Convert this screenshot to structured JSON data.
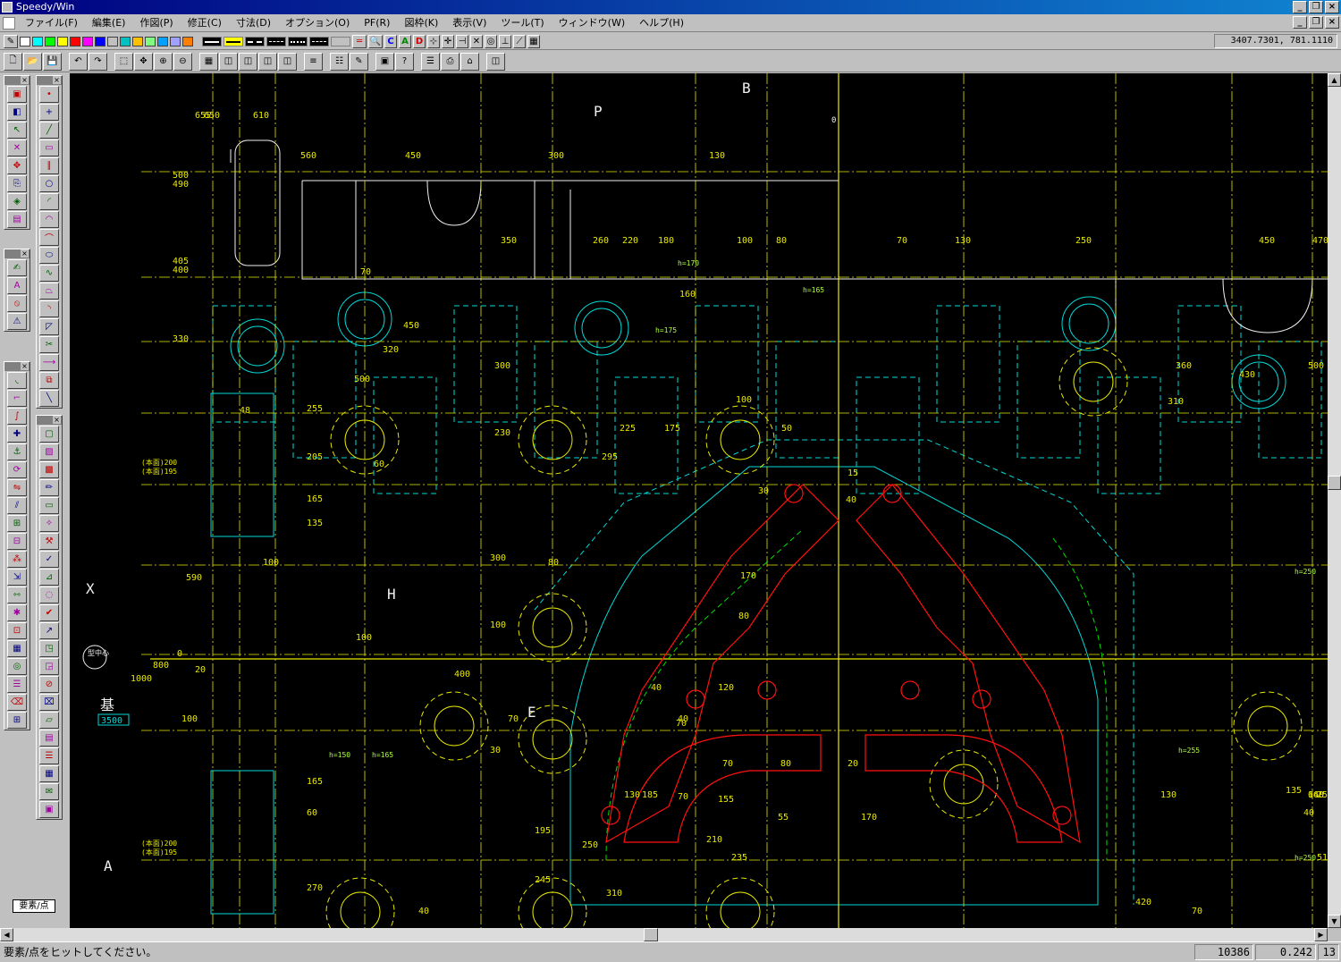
{
  "window": {
    "title": "Speedy/Win"
  },
  "menu": [
    "ファイル(F)",
    "編集(E)",
    "作図(P)",
    "修正(C)",
    "寸法(D)",
    "オプション(O)",
    "PF(R)",
    "図枠(K)",
    "表示(V)",
    "ツール(T)",
    "ウィンドウ(W)",
    "ヘルプ(H)"
  ],
  "toolbar": {
    "coords": "3407.7301,   781.1110",
    "icons": [
      "new-icon",
      "open-icon",
      "save-icon",
      "undo-icon",
      "redo-icon",
      "zoom-window-icon",
      "zoom-pan-icon",
      "zoom-all-icon",
      "zoom-out-icon",
      "calculator-icon",
      "data-1-icon",
      "data-2-icon",
      "data-3-icon",
      "data-4-icon",
      "layer-icon",
      "layer-list-icon",
      "pen-icon",
      "display-icon",
      "help-pointer-icon",
      "property-icon",
      "print-icon",
      "plot-icon",
      "data-5-icon"
    ],
    "swatch_colors": [
      "#ffffff",
      "#00ffff",
      "#00ff00",
      "#ffff00",
      "#ff0000",
      "#ff00ff",
      "#0000ff",
      "#c0c0c0",
      "#00c0c0",
      "#ffc000",
      "#80ff80",
      "#00a0ff",
      "#a0a0ff",
      "#ff8000"
    ]
  },
  "palettes": {
    "a_icons": [
      "file-open-icon",
      "file-save-icon",
      "select-arrow-icon",
      "delete-icon",
      "move-icon",
      "copy-icon",
      "layer-change-icon",
      "hatch-icon"
    ],
    "b_icons": [
      "point-icon",
      "line-cross-icon",
      "line-icon",
      "rect-icon",
      "parallel-icon",
      "circle-icon",
      "arc-icon",
      "arc-3pt-icon",
      "tangent-icon",
      "ellipse-icon",
      "spline-icon",
      "polyline-icon",
      "fillet-icon",
      "chamfer-icon",
      "trim-icon",
      "extend-icon",
      "offset-icon",
      "diag-line-icon"
    ],
    "c_icons": [
      "dimension-icon",
      "text-icon",
      "balloon-icon",
      "warning-icon"
    ],
    "d_icons": [
      "arc-dim-icon",
      "corner-icon",
      "curve-icon",
      "cross-snap-icon",
      "anchor-icon",
      "rotate-icon",
      "mirror-icon",
      "split-icon",
      "join-icon",
      "break-icon",
      "array-icon",
      "scale-icon",
      "stretch-icon",
      "explode-icon",
      "group-icon",
      "table-icon",
      "circle-snap-icon",
      "list-icon",
      "eraser-icon",
      "grid-icon"
    ],
    "e_icons": [
      "box-icon",
      "hatch-pattern-icon",
      "fill-icon",
      "pencil-icon",
      "frame-icon",
      "symbol-icon",
      "weld-icon",
      "finish-icon",
      "tolerance-icon",
      "datum-icon",
      "check-icon",
      "leader-icon",
      "detail-icon",
      "view-icon",
      "section-icon",
      "rubber-icon",
      "print-area-icon",
      "data-table-icon",
      "bom-icon",
      "stamp-icon",
      "note-icon",
      "frame-2-icon"
    ]
  },
  "mode_label": "要素/点",
  "drawing": {
    "labels": [
      "P",
      "B",
      "A",
      "H",
      "E",
      "X",
      "0"
    ],
    "dims_yellow": [
      "655",
      "650",
      "610",
      "560",
      "450",
      "300",
      "130",
      "500",
      "490",
      "405",
      "400",
      "350",
      "260",
      "220",
      "180",
      "160",
      "100",
      "80",
      "70",
      "130",
      "250",
      "450",
      "470",
      "360",
      "330",
      "70",
      "450",
      "320",
      "300",
      "255",
      "230",
      "205",
      "165",
      "135",
      "500",
      "225",
      "295",
      "175",
      "100",
      "50",
      "15",
      "40",
      "430",
      "500",
      "310",
      "48",
      "60",
      "100",
      "590",
      "80",
      "300",
      "100",
      "30",
      "170",
      "80",
      "1000",
      "800",
      "0",
      "20",
      "100",
      "400",
      "70",
      "40",
      "120",
      "70",
      "40",
      "30",
      "70",
      "80",
      "70",
      "100",
      "55",
      "20",
      "170",
      "155",
      "130",
      "130",
      "160",
      "135",
      "165",
      "60",
      "185",
      "195",
      "210",
      "235",
      "245",
      "270",
      "40",
      "25",
      "250",
      "310",
      "420",
      "510",
      "40",
      "640",
      "70"
    ],
    "dims_small": [
      "h=170",
      "h=165",
      "h=175",
      "h=150",
      "h=165",
      "h=250",
      "h=255",
      "h=250"
    ],
    "stamps": [
      "型\n中心",
      "基",
      "3500"
    ],
    "notes_text": [
      "(本面)200",
      "(本面)195"
    ]
  },
  "status": {
    "message": "要素/点をヒットしてください。",
    "count": "10386",
    "scale": "0.242",
    "layer": "13"
  }
}
